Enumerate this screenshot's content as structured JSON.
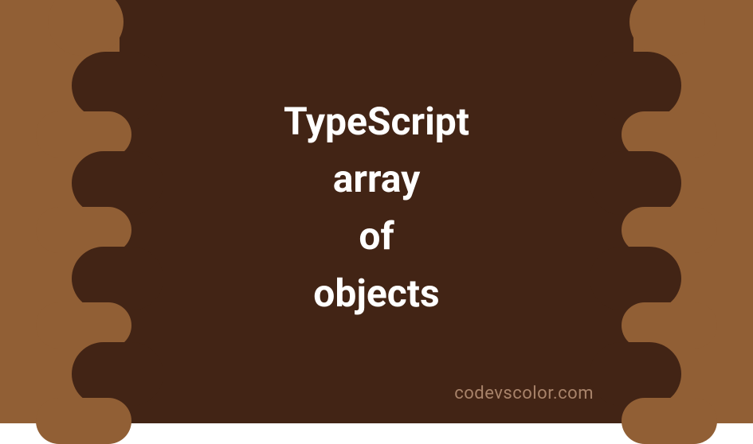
{
  "title": {
    "line1": "TypeScript",
    "line2": "array",
    "line3": "of",
    "line4": "objects"
  },
  "watermark": "codevscolor.com",
  "colors": {
    "background_outer": "#915f35",
    "background_inner": "#422415",
    "text_primary": "#ffffff",
    "text_watermark": "#a8836a"
  }
}
